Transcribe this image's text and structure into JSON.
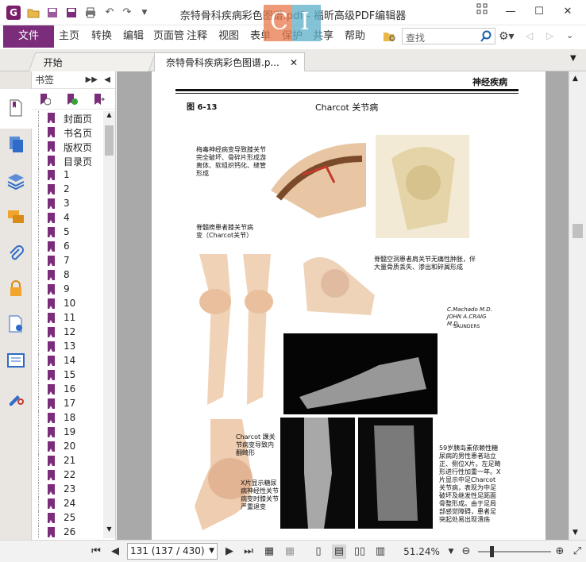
{
  "window": {
    "title": "奈特骨科疾病彩色图谱.pdf - 福昕高级PDF编辑器"
  },
  "menu": {
    "file": "文件",
    "items": [
      "主页",
      "转换",
      "编辑",
      "页面管",
      "注释",
      "视图",
      "表单",
      "保护",
      "共享",
      "帮助"
    ]
  },
  "search": {
    "placeholder": "查找"
  },
  "tabs": [
    {
      "label": "开始"
    },
    {
      "label": "奈特骨科疾病彩色图谱.p..."
    }
  ],
  "bookmarks": {
    "title": "书签",
    "items": [
      "封面页",
      "书名页",
      "版权页",
      "目录页",
      "1",
      "2",
      "3",
      "4",
      "5",
      "6",
      "7",
      "8",
      "9",
      "10",
      "11",
      "12",
      "13",
      "14",
      "15",
      "16",
      "17",
      "18",
      "19",
      "20",
      "21",
      "22",
      "23",
      "24",
      "25",
      "26"
    ]
  },
  "page": {
    "section": "神经疾病",
    "figure": "图 6-13",
    "heading": "Charcot 关节病",
    "caption1": "梅毒神经病变导致膝关节完全破坏、骨碎片形成游离体、软组织钙化、缝管形成",
    "caption2": "脊髓痨患者膝关节病变（Charcot关节）",
    "caption3": "脊髓空洞患者肩关节无痛性肿胀，伴大量骨质丢失、渗出和碎屑形成",
    "caption4": "Charcot 踝关节病变导致内翻畸形",
    "caption5": "X片显示糖尿病神经性关节病变时膝关节严重退变",
    "caption6": "59岁胰岛素依赖性糖尿病的男性患者站立正、侧位X片。左足畸形进行性加重一年。X片显示中足Charcot关节病，表现为中足破坏及继发性足跖面骨整形成。由于足局部感觉障碍，患者足突起处易出现溃疡",
    "signature": "C.Machado M.D.  JOHN A.CRAIG M.D.",
    "publisher": "SAUNDERS"
  },
  "status": {
    "page_input": "131 (137 / 430)",
    "zoom": "51.24%"
  },
  "colors": {
    "accent": "#7b2c7a",
    "doc_bg": "#a9a9a9"
  }
}
